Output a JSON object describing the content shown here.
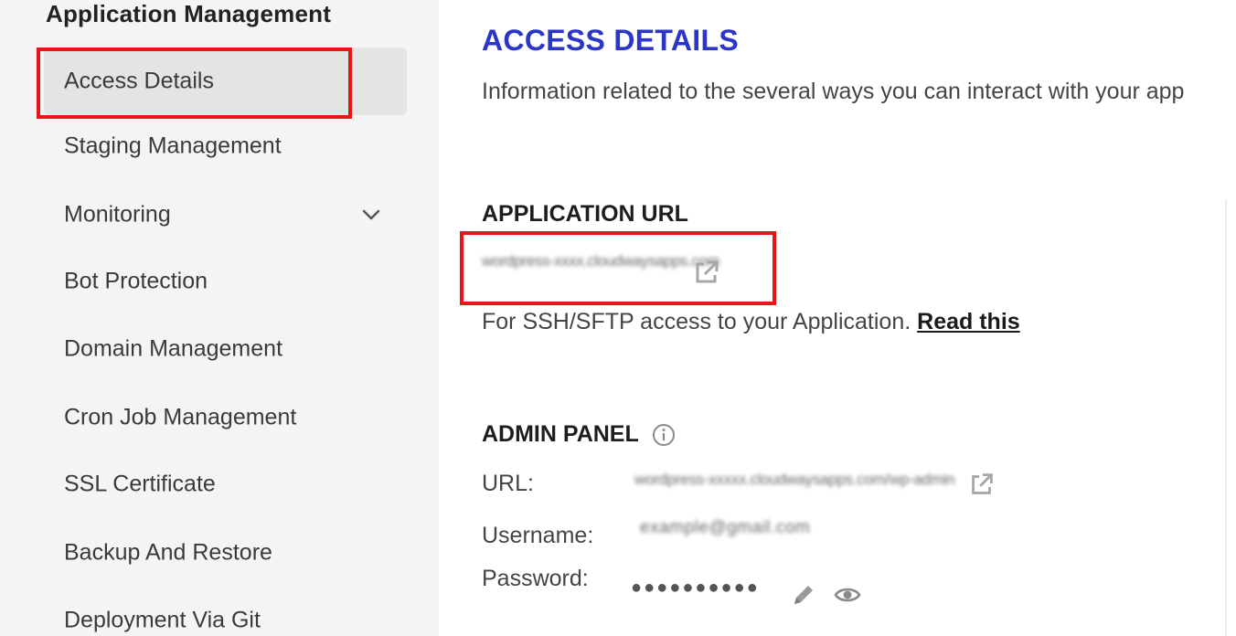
{
  "sidebar": {
    "heading": "Application Management",
    "items": [
      {
        "label": "Access Details",
        "active": true
      },
      {
        "label": "Staging Management"
      },
      {
        "label": "Monitoring",
        "has_dropdown": true
      },
      {
        "label": "Bot Protection"
      },
      {
        "label": "Domain Management"
      },
      {
        "label": "Cron Job Management"
      },
      {
        "label": "SSL Certificate"
      },
      {
        "label": "Backup And Restore"
      },
      {
        "label": "Deployment Via Git"
      }
    ]
  },
  "main": {
    "title": "ACCESS DETAILS",
    "description": "Information related to the several ways you can interact with your app",
    "application_url": {
      "title": "APPLICATION URL",
      "value": "wordpress-xxxx.cloudwaysapps.com",
      "value_icon": "external-link-icon"
    },
    "ssh_note": {
      "text": "For SSH/SFTP access to your Application.",
      "link": "Read this"
    },
    "admin_panel": {
      "title": "ADMIN PANEL",
      "info_icon": "info-icon",
      "url_label": "URL:",
      "url_value": "wordpress-xxxxx.cloudwaysapps.com/wp-admin",
      "username_label": "Username:",
      "username_value": "example@gmail.com",
      "password_label": "Password:",
      "password_value": "●●●●●●●●●●"
    }
  },
  "colors": {
    "title": "#2b36c9",
    "highlight": "#e8141a",
    "sidebar_bg": "#f4f4f4",
    "active_bg": "#e4e4e4"
  }
}
